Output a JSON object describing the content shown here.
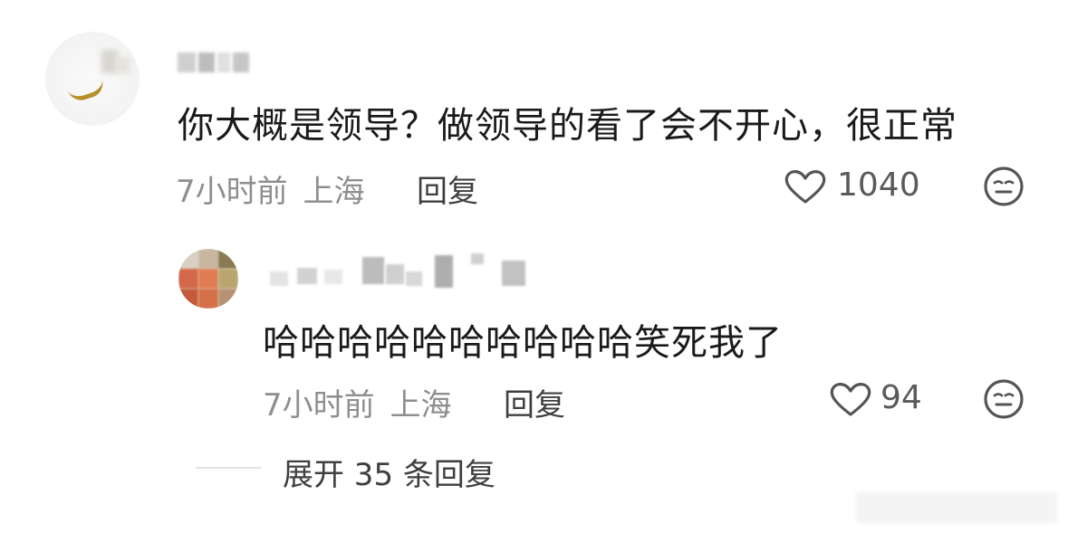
{
  "comment": {
    "text": "你大概是领导？做领导的看了会不开心，很正常",
    "time": "7小时前",
    "location": "上海",
    "reply_label": "回复",
    "likes": "1040",
    "like_icon": "heart-outline-icon",
    "reaction_icon": "neutral-face-icon"
  },
  "reply": {
    "text": "哈哈哈哈哈哈哈哈哈哈笑死我了",
    "time": "7小时前",
    "location": "上海",
    "reply_label": "回复",
    "likes": "94",
    "like_icon": "heart-outline-icon",
    "reaction_icon": "neutral-face-icon"
  },
  "expand_label": "展开 35 条回复",
  "colors": {
    "text_primary": "#1a1a1a",
    "text_secondary": "#8e8e8e",
    "text_action": "#3f3f3f",
    "icon": "#555555"
  }
}
